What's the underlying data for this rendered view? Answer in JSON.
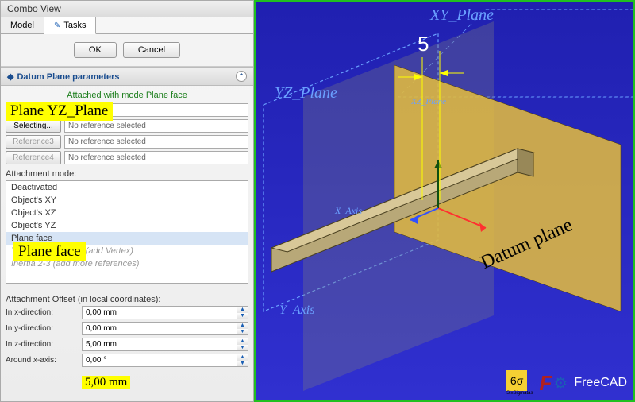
{
  "panel": {
    "title": "Combo View",
    "tabs": {
      "model": "Model",
      "tasks": "Tasks"
    },
    "buttons": {
      "ok": "OK",
      "cancel": "Cancel"
    },
    "section_title": "Datum Plane parameters",
    "attached_text": "Attached with mode Plane face",
    "refs": {
      "r1_btn": "Plane",
      "r1_val": "YZ_Plane",
      "r2_btn": "Selecting...",
      "r2_val": "No reference selected",
      "r3_btn": "Reference3",
      "r3_val": "No reference selected",
      "r4_btn": "Reference4",
      "r4_val": "No reference selected"
    },
    "mode_label": "Attachment mode:",
    "modes": {
      "m0": "Deactivated",
      "m1": "Object's XY",
      "m2": "Object's XZ",
      "m3": "Object's YZ",
      "m4": "Plane face",
      "m5": "Tangent to surface (add Vertex)",
      "m6": "Inertia 2-3 (add more references)"
    },
    "offset_header": "Attachment Offset (in local coordinates):",
    "offsets": {
      "x_lbl": "In x-direction:",
      "x_val": "0,00 mm",
      "y_lbl": "In y-direction:",
      "y_val": "0,00 mm",
      "z_lbl": "In z-direction:",
      "z_val": "5,00 mm",
      "ax_lbl": "Around x-axis:",
      "ax_val": "0,00 °"
    }
  },
  "highlights": {
    "plane_ref": "Plane  YZ_Plane",
    "plane_face": "Plane face",
    "z_val": "5,00 mm"
  },
  "viewport": {
    "xy_label": "XY_Plane",
    "yz_label": "YZ_Plane",
    "yz_small": "XZ_Plane",
    "x_axis": "X_Axis",
    "y_axis": "Y_Axis",
    "dim_value": "5",
    "datum_label": "Datum plane",
    "app_name": "FreeCAD",
    "sigma_label": "SixSigmatas"
  }
}
